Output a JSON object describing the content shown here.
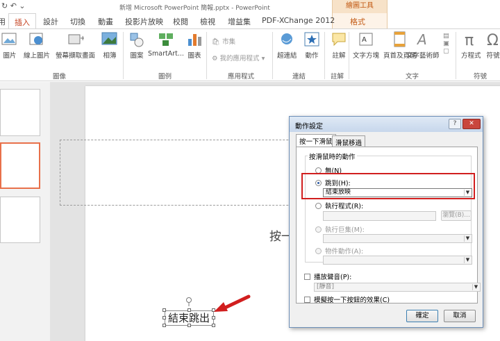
{
  "window": {
    "title": "新增 Microsoft PowerPoint 簡報.pptx - PowerPoint",
    "context_header": "繪圖工具"
  },
  "tabs": [
    "常用",
    "插入",
    "設計",
    "切換",
    "動畫",
    "投影片放映",
    "校閱",
    "檢視",
    "增益集",
    "PDF-XChange 2012",
    "格式"
  ],
  "ribbon": {
    "images": {
      "picture": "圖片",
      "online_picture": "線上圖片",
      "screenshot": "螢幕擷取畫面",
      "album": "相簿",
      "label": "圖像"
    },
    "illustrations": {
      "shapes": "圖案",
      "smartart": "SmartArt...",
      "chart": "圖表",
      "label": "圖例"
    },
    "apps": {
      "store": "市集",
      "my_apps": "我的應用程式",
      "label": "應用程式"
    },
    "links": {
      "hyperlink": "超連結",
      "action": "動作",
      "label": "連結"
    },
    "comments": {
      "comment": "註解",
      "label": "註解"
    },
    "text": {
      "textbox": "文字方塊",
      "header_footer": "頁首及頁尾",
      "wordart": "文字藝術師",
      "label": "文字"
    },
    "symbols": {
      "equation": "方程式",
      "symbol": "符號",
      "label": "符號"
    }
  },
  "slide": {
    "placeholder_text": "按一",
    "textbox_text": "結束跳出"
  },
  "dialog": {
    "title": "動作設定",
    "help": "?",
    "close": "✕",
    "tab_click": "按一下滑鼠",
    "tab_hover": "滑鼠移過",
    "group_label": "按滑鼠時的動作",
    "opt_none": "無(N)",
    "opt_jump": "跳到(H):",
    "jump_value": "結束放映",
    "opt_run_program": "執行程式(R):",
    "browse": "瀏覽(B)...",
    "opt_run_macro": "執行巨集(M):",
    "opt_object_action": "物件動作(A):",
    "play_sound": "播放聲音(P):",
    "sound_value": "[靜音]",
    "highlight_click": "模擬按一下按鈕的效果(C)",
    "ok": "確定",
    "cancel": "取消"
  },
  "colors": {
    "accent": "#c43e1c",
    "context": "#c25a14",
    "highlight_box": "#d11e1e",
    "arrow": "#d11e1e"
  }
}
